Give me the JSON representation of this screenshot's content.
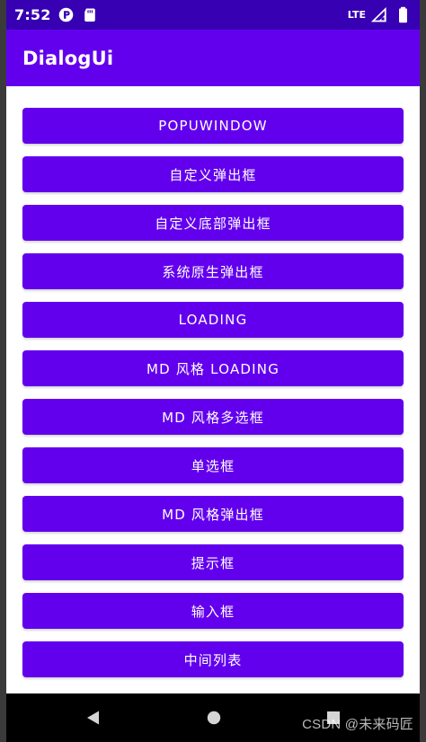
{
  "status_bar": {
    "time": "7:52",
    "network": "LTE",
    "icons": [
      "app-icon",
      "sd-card-icon",
      "signal-icon",
      "battery-icon"
    ],
    "color": "#3700b3"
  },
  "toolbar": {
    "title": "DialogUi",
    "color": "#6200ee"
  },
  "buttons": [
    "POPUWINDOW",
    "自定义弹出框",
    "自定义底部弹出框",
    "系统原生弹出框",
    "LOADING",
    "MD 风格 LOADING",
    "MD 风格多选框",
    "单选框",
    "MD 风格弹出框",
    "提示框",
    "输入框",
    "中间列表"
  ],
  "navigation": {
    "icons": [
      "back-icon",
      "home-icon",
      "recent-apps-icon"
    ]
  },
  "watermark": "CSDN @未来码匠"
}
